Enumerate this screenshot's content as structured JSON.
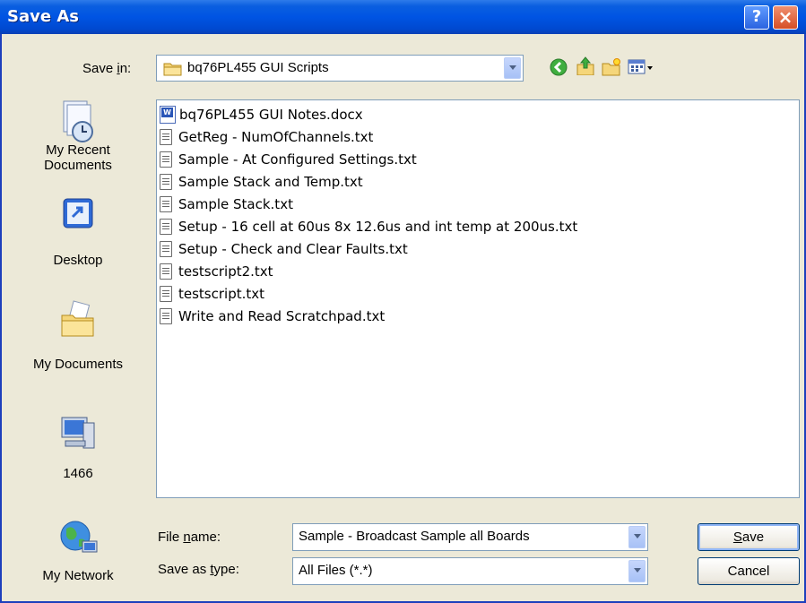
{
  "window": {
    "title": "Save As",
    "help_label": "?",
    "close_label": "×"
  },
  "save_in": {
    "label_pre": "Save ",
    "label_key": "i",
    "label_post": "n:",
    "value": "bq76PL455 GUI Scripts"
  },
  "places": [
    {
      "label_line1": "My Recent",
      "label_line2": "Documents",
      "icon": "recent-documents-icon"
    },
    {
      "label_line1": "Desktop",
      "label_line2": "",
      "icon": "desktop-icon"
    },
    {
      "label_line1": "My Documents",
      "label_line2": "",
      "icon": "my-documents-icon"
    },
    {
      "label_line1": "1466",
      "label_line2": "",
      "icon": "my-computer-icon"
    },
    {
      "label_line1": "My Network",
      "label_line2": "",
      "icon": "my-network-icon"
    }
  ],
  "files": [
    "bq76PL455 GUI Notes.docx",
    "GetReg - NumOfChannels.txt",
    "Sample - At Configured Settings.txt",
    "Sample Stack and Temp.txt",
    "Sample Stack.txt",
    "Setup - 16 cell at 60us 8x 12.6us and int temp at 200us.txt",
    "Setup - Check and Clear Faults.txt",
    "testscript2.txt",
    "testscript.txt",
    "Write and Read Scratchpad.txt"
  ],
  "file_name": {
    "label_pre": "File ",
    "label_key": "n",
    "label_post": "ame:",
    "value": "Sample - Broadcast Sample all Boards"
  },
  "save_as_type": {
    "label_pre": "Save as ",
    "label_key": "t",
    "label_post": "ype:",
    "value": "All Files (*.*)"
  },
  "buttons": {
    "save_key": "S",
    "save_rest": "ave",
    "cancel": "Cancel"
  }
}
